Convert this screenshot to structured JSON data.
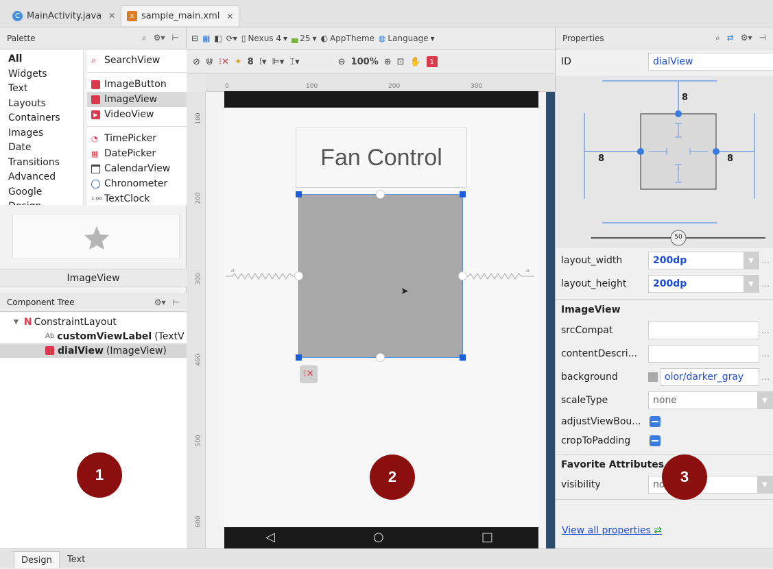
{
  "file_tabs": [
    {
      "label": "MainActivity.java",
      "icon": "java-class-icon"
    },
    {
      "label": "sample_main.xml",
      "icon": "xml-file-icon"
    }
  ],
  "palette": {
    "title": "Palette",
    "categories": [
      "All",
      "Widgets",
      "Text",
      "Layouts",
      "Containers",
      "Images",
      "Date",
      "Transitions",
      "Advanced",
      "Google",
      "Design"
    ],
    "items": [
      "SearchView",
      "ImageButton",
      "ImageView",
      "VideoView",
      "TimePicker",
      "DatePicker",
      "CalendarView",
      "Chronometer",
      "TextClock"
    ],
    "selected_item": "ImageView",
    "preview_label": "ImageView"
  },
  "component_tree": {
    "title": "Component Tree",
    "root": "ConstraintLayout",
    "children": [
      {
        "prefix": "Ab",
        "name": "customViewLabel",
        "type": "(TextV"
      },
      {
        "name": "dialView",
        "type": "(ImageView)"
      }
    ]
  },
  "design_toolbar": {
    "device": "Nexus 4",
    "api": "25",
    "theme": "AppTheme",
    "language": "Language",
    "margin": "8",
    "zoom": "100%",
    "warnings": "1"
  },
  "rulers": {
    "top": [
      "0",
      "100",
      "200",
      "300"
    ],
    "left": [
      "100",
      "200",
      "300",
      "400",
      "500",
      "600"
    ]
  },
  "canvas": {
    "label_text": "Fan Control"
  },
  "badges": [
    "1",
    "2",
    "3"
  ],
  "properties": {
    "title": "Properties",
    "id_label": "ID",
    "id_value": "dialView",
    "margin_top": "8",
    "margin_left": "8",
    "margin_right": "8",
    "bias": "50",
    "layout_width_label": "layout_width",
    "layout_width": "200dp",
    "layout_height_label": "layout_height",
    "layout_height": "200dp",
    "section": "ImageView",
    "src_label": "srcCompat",
    "desc_label": "contentDescri...",
    "bg_label": "background",
    "bg_value": "olor/darker_gray",
    "scale_label": "scaleType",
    "scale_value": "none",
    "adjust_label": "adjustViewBou...",
    "crop_label": "cropToPadding",
    "fav_section": "Favorite Attributes",
    "vis_label": "visibility",
    "vis_value": "no",
    "view_all": "View all properties"
  },
  "bottom_tabs": [
    "Design",
    "Text"
  ]
}
